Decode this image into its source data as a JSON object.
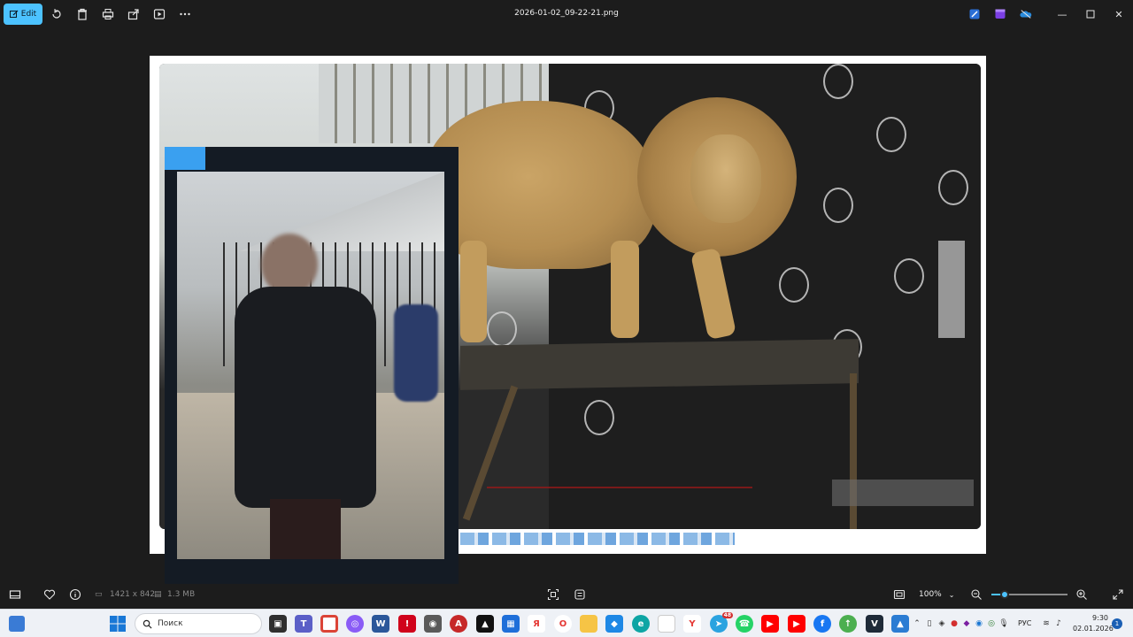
{
  "toolbar": {
    "edit_label": "Edit",
    "file_name": "2026-01-02_09-22-21.png"
  },
  "statusbar": {
    "dimensions": "1421 x 842",
    "file_size": "1.3 MB",
    "zoom": "100%",
    "zoom_level": 0.18
  },
  "taskbar": {
    "search_placeholder": "Поиск",
    "language": "РУС",
    "time": "9:30",
    "date": "02.01.2026",
    "notification_count": "1",
    "telegram_badge": "48"
  },
  "colors": {
    "accent": "#4cc2ff",
    "background": "#1c1c1c",
    "taskbar": "#eef1f6"
  },
  "icons": {
    "toolbar": [
      "rotate-icon",
      "delete-icon",
      "print-icon",
      "share-icon",
      "slideshow-icon",
      "more-icon"
    ],
    "titlebar": [
      "paint-icon",
      "clipchamp-icon",
      "onedrive-icon",
      "minimize-icon",
      "maximize-icon",
      "close-icon"
    ],
    "bottombar": [
      "filmstrip-icon",
      "favorite-icon",
      "info-icon",
      "fit-icon",
      "compare-icon",
      "fit-window-icon",
      "zoom-out-icon",
      "zoom-in-icon",
      "fullscreen-icon"
    ]
  }
}
